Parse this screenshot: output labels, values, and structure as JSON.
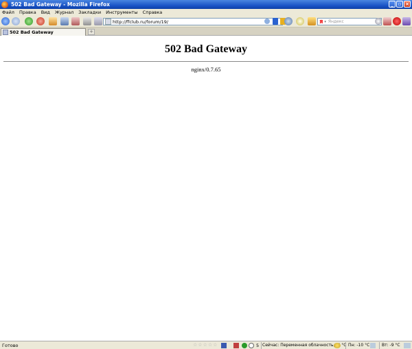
{
  "window": {
    "title": "502 Bad Gateway - Mozilla Firefox"
  },
  "menu": {
    "items": [
      "Файл",
      "Правка",
      "Вид",
      "Журнал",
      "Закладки",
      "Инструменты",
      "Справка"
    ]
  },
  "navigation": {
    "url": "http://ffclub.ru/forum/19/",
    "search_engine_label": "Я",
    "search_placeholder": "Яндекс"
  },
  "tabs": [
    {
      "label": "502 Bad Gateway"
    }
  ],
  "page": {
    "heading": "502 Bad Gateway",
    "server": "nginx/0.7.65"
  },
  "status": {
    "text": "Готово",
    "rating_stars": 5,
    "counter": "5",
    "weather_now": "Сейчас: Переменная облачность, -6 °C",
    "weather_mon": "Пн: -10 °C",
    "weather_tue": "Вт: -9 °C"
  },
  "colors": {
    "titlebar": "#1b56c8",
    "chrome": "#ece9d8"
  }
}
